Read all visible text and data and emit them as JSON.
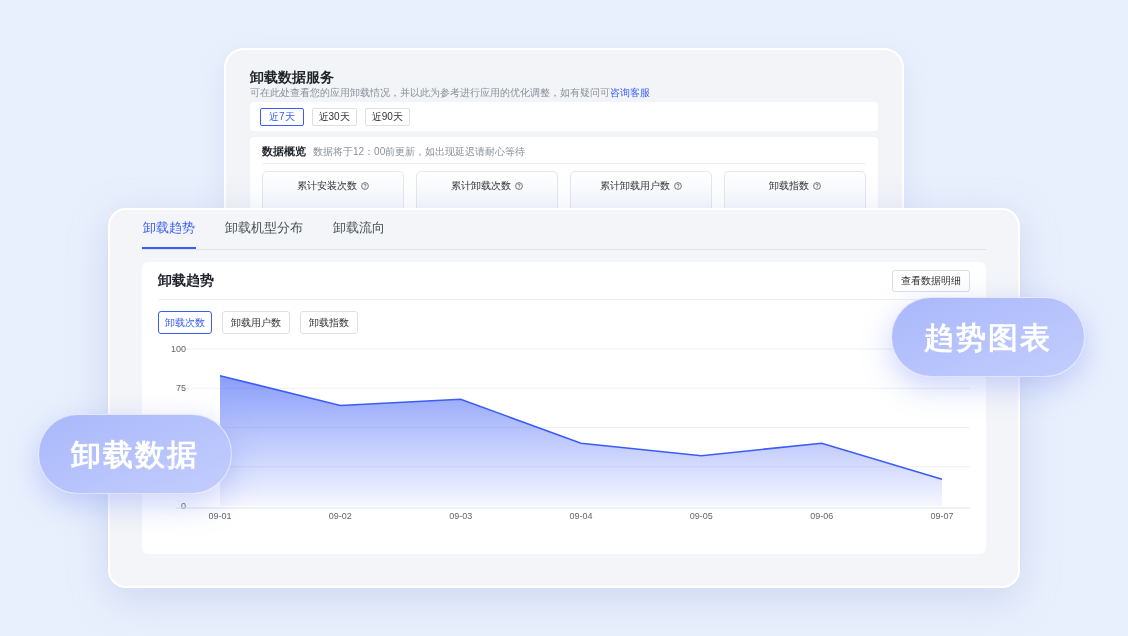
{
  "back_panel": {
    "title": "卸载数据服务",
    "subtitle": "可在此处查看您的应用卸载情况，并以此为参考进行应用的优化调整，如有疑问可",
    "subtitle_link": "咨询客服",
    "ranges": [
      {
        "label": "近7天",
        "selected": true
      },
      {
        "label": "近30天",
        "selected": false
      },
      {
        "label": "近90天",
        "selected": false
      }
    ],
    "overview": {
      "title": "数据概览",
      "note": "数据将于12：00前更新，如出现延迟请耐心等待",
      "cards": [
        {
          "label": "累计安装次数"
        },
        {
          "label": "累计卸载次数"
        },
        {
          "label": "累计卸载用户数"
        },
        {
          "label": "卸载指数"
        }
      ]
    }
  },
  "front_panel": {
    "tabs": [
      {
        "label": "卸载趋势",
        "selected": true
      },
      {
        "label": "卸载机型分布",
        "selected": false
      },
      {
        "label": "卸载流向",
        "selected": false
      }
    ],
    "card": {
      "title": "卸载趋势",
      "detail_button": "查看数据明细",
      "metrics": [
        {
          "label": "卸载次数",
          "selected": true
        },
        {
          "label": "卸载用户数",
          "selected": false
        },
        {
          "label": "卸载指数",
          "selected": false
        }
      ],
      "chart_data": {
        "type": "area",
        "categories": [
          "09-01",
          "09-02",
          "09-03",
          "09-04",
          "09-05",
          "09-06",
          "09-07"
        ],
        "series": [
          {
            "color": "#3b5cf6",
            "values": [
              83,
              64,
              68,
              40,
              32,
              40,
              17
            ]
          }
        ],
        "ylim": [
          0,
          100
        ],
        "yticks": [
          0,
          75,
          100
        ]
      }
    }
  },
  "badges": [
    {
      "text": "卸载数据"
    },
    {
      "text": "趋势图表"
    }
  ]
}
